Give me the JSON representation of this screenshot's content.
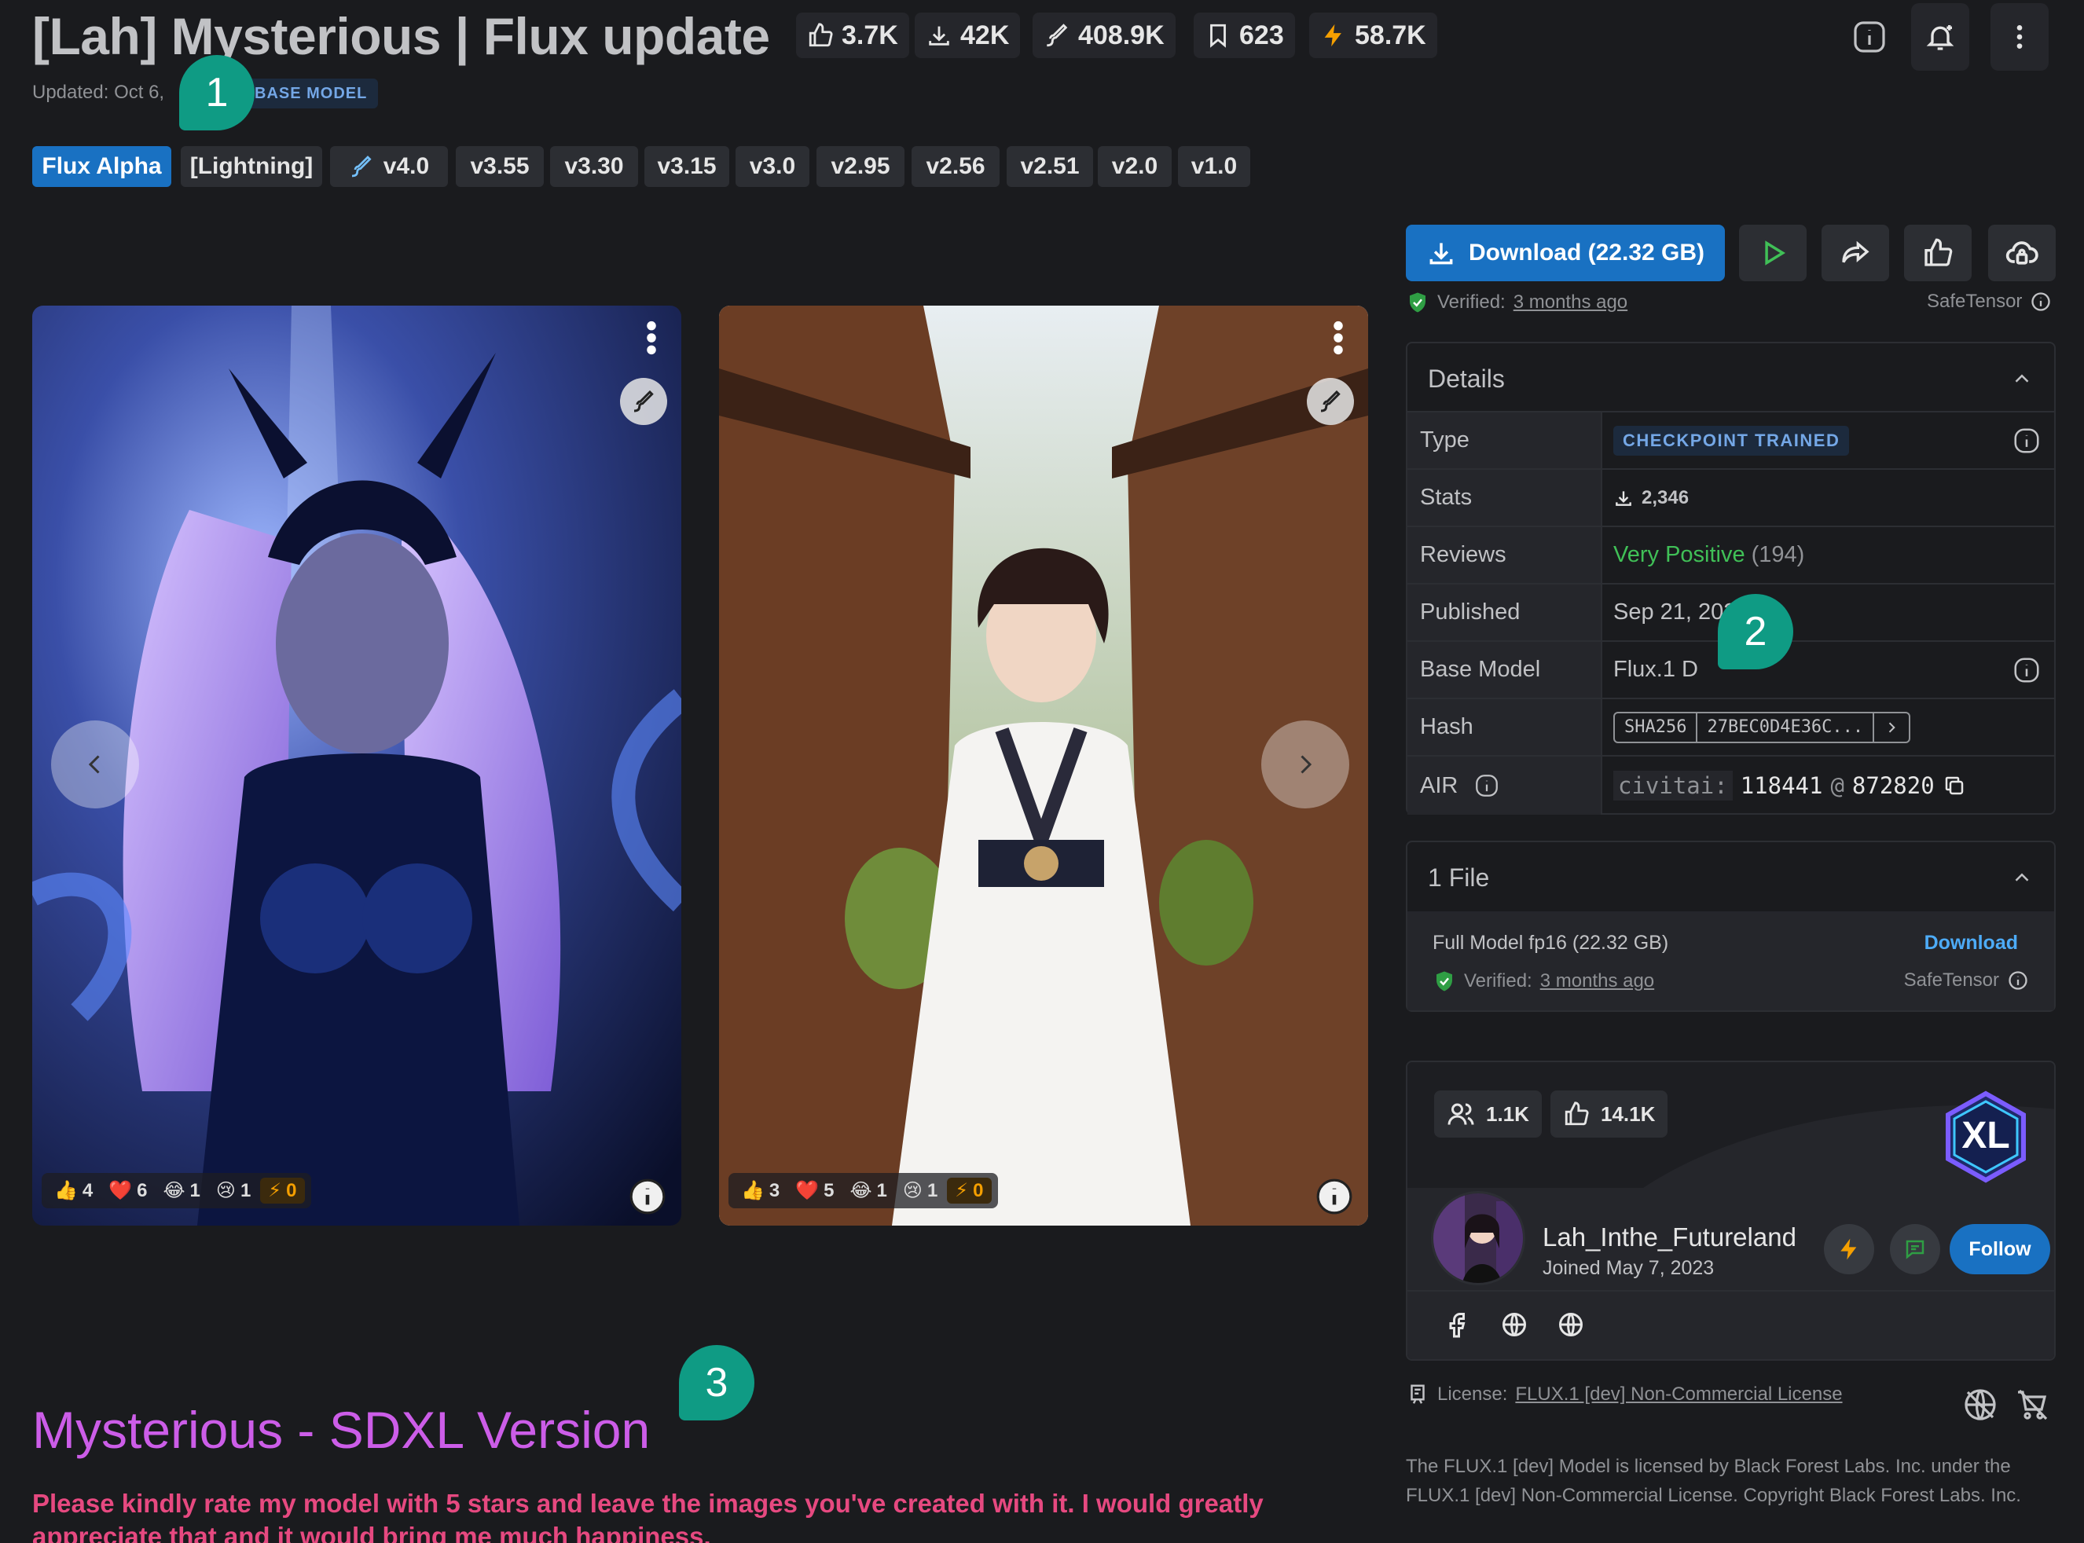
{
  "header": {
    "title": "[Lah] Mysterious | Flux update",
    "stats": [
      {
        "icon": "thumbs-up-icon",
        "value": "3.7K"
      },
      {
        "icon": "download-icon",
        "value": "42K"
      },
      {
        "icon": "brush-icon",
        "value": "408.9K"
      },
      {
        "icon": "bookmark-icon",
        "value": "623"
      },
      {
        "icon": "bolt-icon",
        "value": "58.7K"
      }
    ],
    "updated": "Updated: Oct 6,",
    "base_badge": "BASE MODEL"
  },
  "markers": [
    "1",
    "2",
    "3"
  ],
  "versions": [
    "Flux Alpha",
    "[Lightning]",
    "v4.0",
    "v3.55",
    "v3.30",
    "v3.15",
    "v3.0",
    "v2.95",
    "v2.56",
    "v2.51",
    "v2.0",
    "v1.0"
  ],
  "gallery": [
    {
      "reactions": {
        "like": "4",
        "heart": "6",
        "laugh": "1",
        "cry": "1",
        "bolt": "0"
      }
    },
    {
      "reactions": {
        "like": "3",
        "heart": "5",
        "laugh": "1",
        "cry": "1",
        "bolt": "0"
      }
    }
  ],
  "actions": {
    "download_label": "Download (22.32 GB)",
    "verified_prefix": "Verified:",
    "verified_when": "3 months ago",
    "safetensor": "SafeTensor"
  },
  "details": {
    "title": "Details",
    "rows": {
      "type_k": "Type",
      "type_v": "CHECKPOINT TRAINED",
      "stats_k": "Stats",
      "stats_v": "2,346",
      "reviews_k": "Reviews",
      "reviews_v": "Very Positive",
      "reviews_count": "(194)",
      "published_k": "Published",
      "published_v": "Sep 21, 202",
      "base_k": "Base Model",
      "base_v": "Flux.1 D",
      "hash_k": "Hash",
      "hash_algo": "SHA256",
      "hash_v": "27BEC0D4E36C...",
      "air_k": "AIR",
      "air_prefix": "civitai:",
      "air_model": "118441",
      "air_at": "@",
      "air_version": "872820"
    }
  },
  "files": {
    "title": "1 File",
    "name": "Full Model fp16 (22.32 GB)",
    "download": "Download",
    "verified_prefix": "Verified:",
    "verified_when": "3 months ago",
    "safetensor": "SafeTensor"
  },
  "creator": {
    "followers": "1.1K",
    "likes": "14.1K",
    "badge": "XL",
    "name": "Lah_Inthe_Futureland",
    "joined": "Joined May 7, 2023",
    "follow": "Follow"
  },
  "license": {
    "prefix": "License:",
    "name": "FLUX.1 [dev] Non-Commercial License",
    "text": "The FLUX.1 [dev] Model is licensed by Black Forest Labs. Inc. under the FLUX.1 [dev] Non-Commercial License. Copyright Black Forest Labs. Inc."
  },
  "description": {
    "heading": "Mysterious - SDXL Version",
    "note": "Please kindly rate my model with 5 stars and leave the images you've created with it. I would greatly appreciate that and it would bring me much happiness."
  },
  "colors": {
    "accent": "#1971c2",
    "marker": "#0f9b84",
    "heading": "#cc5de8",
    "note": "#e64980",
    "positive": "#40c057"
  }
}
